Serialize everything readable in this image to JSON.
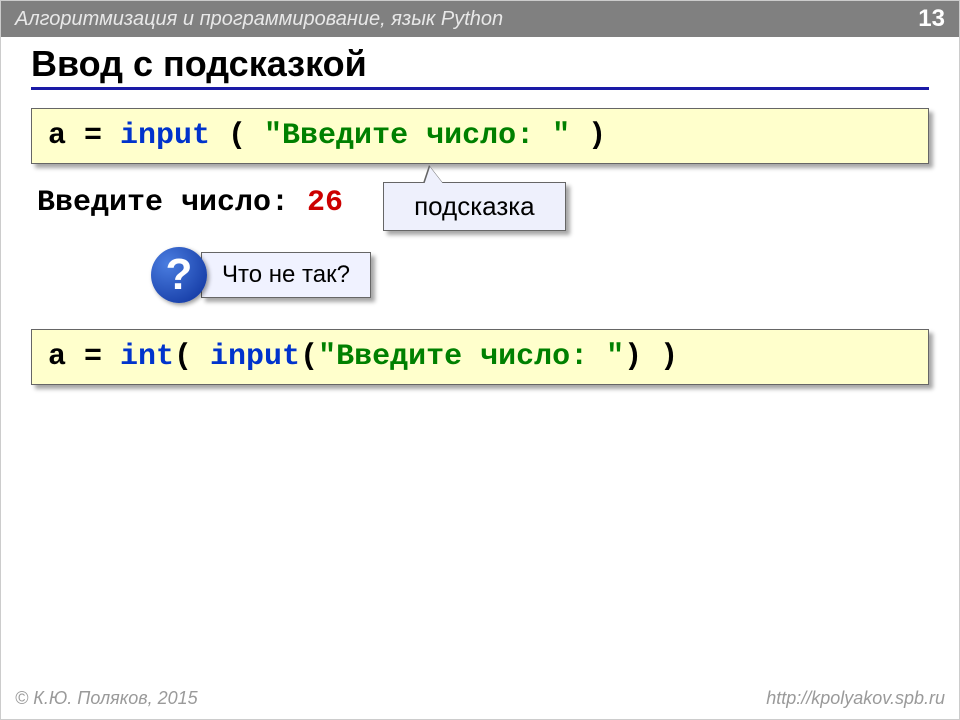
{
  "header": {
    "course_title": "Алгоритмизация и программирование, язык Python",
    "page_number": "13"
  },
  "slide": {
    "title": "Ввод с подсказкой",
    "code1": {
      "p1": "a = ",
      "fn": "input",
      "p2": " ( ",
      "str": "\"Введите число: \"",
      "p3": " )"
    },
    "example": {
      "prompt": "Введите число: ",
      "value": "26"
    },
    "hint_label": "подсказка",
    "question_mark": "?",
    "question_text": "Что не так?",
    "code2": {
      "p1": "a = ",
      "fn1": "int",
      "p2": "( ",
      "fn2": "input",
      "p3": "(",
      "str": "\"Введите число: \"",
      "p4": ") )"
    }
  },
  "footer": {
    "copyright": "© К.Ю. Поляков, 2015",
    "url": "http://kpolyakov.spb.ru"
  }
}
